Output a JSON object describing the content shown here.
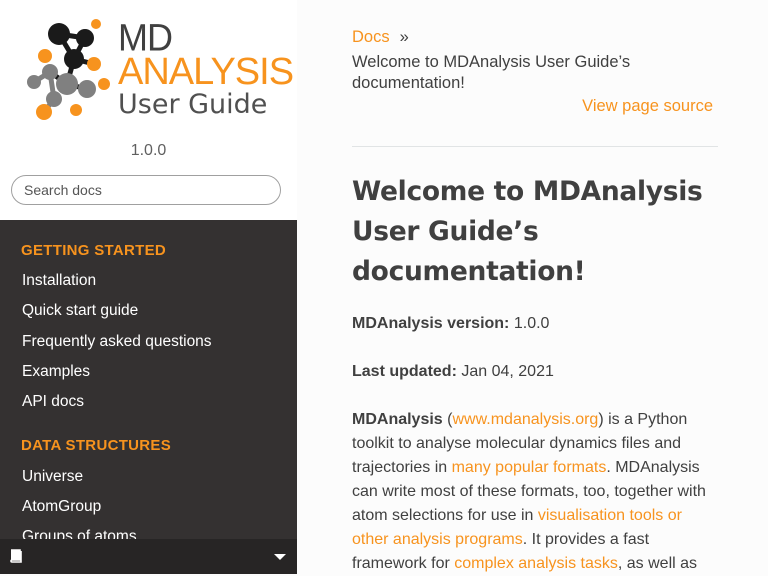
{
  "sidebar": {
    "logo": {
      "line1": "MD",
      "line2": "ANALYSIS",
      "line3": "User Guide"
    },
    "version": "1.0.0",
    "search": {
      "placeholder": "Search docs"
    },
    "sections": [
      {
        "caption": "GETTING STARTED",
        "items": [
          "Installation",
          "Quick start guide",
          "Frequently asked questions",
          "Examples",
          "API docs"
        ]
      },
      {
        "caption": "DATA STRUCTURES",
        "items": [
          "Universe",
          "AtomGroup",
          "Groups of atoms"
        ]
      }
    ],
    "footer": {
      "icon": "book-icon",
      "toggle_icon": "caret-down-icon"
    }
  },
  "breadcrumb": {
    "root": "Docs",
    "separator": "»",
    "current": "Welcome to MDAnalysis User Guide’s documentation!"
  },
  "view_source": "View page source",
  "content": {
    "title": "Welcome to MDAnalysis User Guide’s documentation!",
    "version_label": "MDAnalysis version:",
    "version_value": "1.0.0",
    "updated_label": "Last updated:",
    "updated_value": "Jan 04, 2021",
    "intro": {
      "name": "MDAnalysis",
      "open_paren": " (",
      "link_site": "www.mdanalysis.org",
      "t1": ") is a Python toolkit to analyse molecular dynamics files and trajectories in ",
      "link_formats": "many popular formats",
      "t2": ". MDAnalysis can write most of these formats, too, together with atom selections for use in ",
      "link_visualisation": "visualisation tools or other analysis programs",
      "t3": ". It provides a fast framework for ",
      "link_analysis": "complex analysis tasks",
      "t4": ", as well as"
    }
  },
  "colors": {
    "accent": "#f7931e",
    "sidebar_bg": "#343131",
    "text": "#404040"
  }
}
